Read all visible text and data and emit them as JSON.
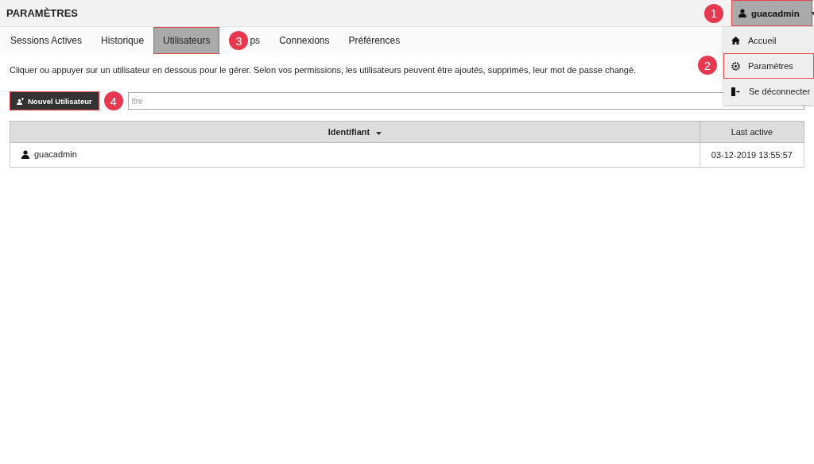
{
  "header": {
    "title": "PARAMÈTRES",
    "user_button": {
      "label": "guacadmin",
      "highlighted": true,
      "callout": "1"
    }
  },
  "user_menu": {
    "items": [
      {
        "label": "Accueil",
        "kind": "home",
        "highlighted": false
      },
      {
        "label": "Paramètres",
        "kind": "settings",
        "highlighted": true,
        "callout": "2"
      },
      {
        "label": "Se déconnecter",
        "kind": "logout",
        "highlighted": false
      }
    ]
  },
  "tabs": [
    {
      "label": "Sessions Actives",
      "selected": false,
      "highlighted": false
    },
    {
      "label": "Historique",
      "selected": false,
      "highlighted": false
    },
    {
      "label": "Utilisateurs",
      "selected": true,
      "highlighted": true
    },
    {
      "label": "ps",
      "selected": false,
      "highlighted": false,
      "callout": "3"
    },
    {
      "label": "Connexions",
      "selected": false,
      "highlighted": false
    },
    {
      "label": "Préférences",
      "selected": false,
      "highlighted": false
    }
  ],
  "description": "Cliquer ou appuyer sur un utilisateur en dessous pour le gérer. Selon vos permissions, les utilisateurs peuvent être ajoutés, supprimés, leur mot de passe changé.",
  "new_user_button": {
    "label": "Nouvel Utilisateur",
    "highlighted": true,
    "callout": "4"
  },
  "filter": {
    "placeholder": "ltre"
  },
  "table": {
    "columns": [
      {
        "label": "Identifiant",
        "sorted": true
      },
      {
        "label": "Last active",
        "sorted": false
      }
    ],
    "rows": [
      {
        "username": "guacadmin",
        "last_active": "03-12-2019 13:55:57"
      }
    ]
  }
}
